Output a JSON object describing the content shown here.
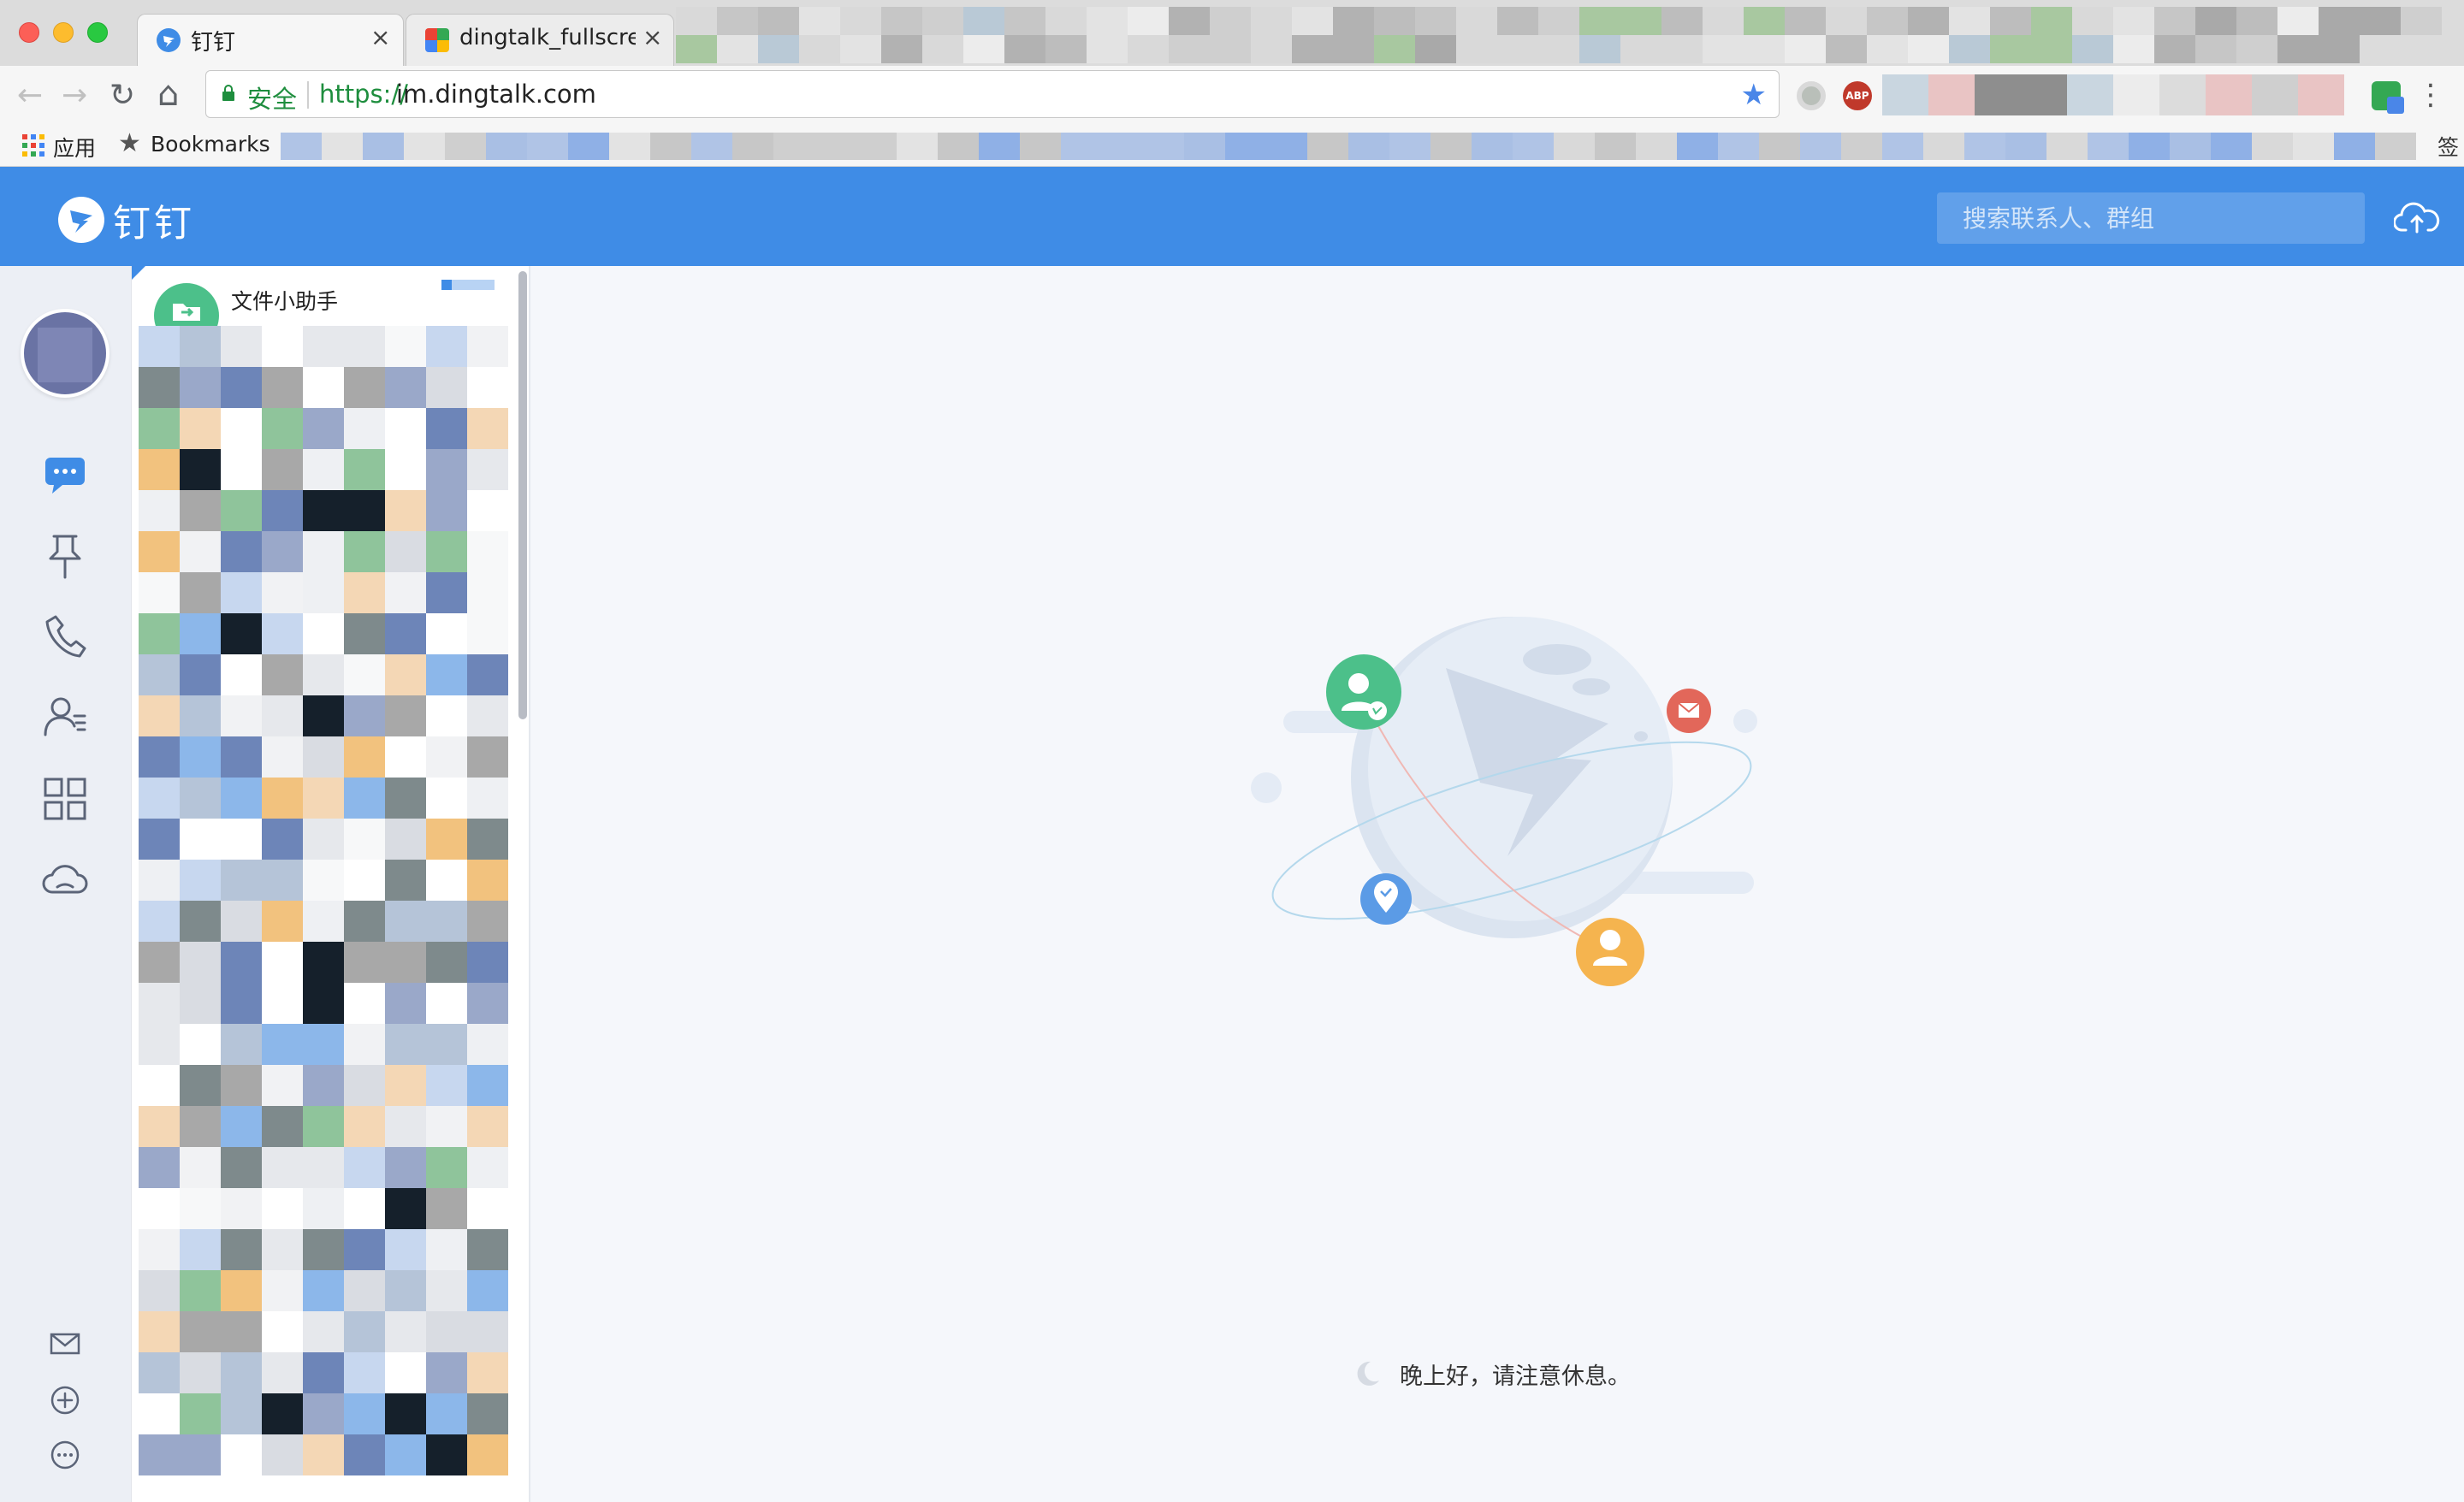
{
  "browser": {
    "tabs": [
      {
        "title": "钉钉",
        "favicon": "dingtalk-icon",
        "active": true
      },
      {
        "title": "dingtalk_fullscreen",
        "favicon": "chrome-extension-icon",
        "active": false
      }
    ],
    "close_glyph": "×",
    "omnibox": {
      "secure_label": "安全",
      "url_scheme": "https://",
      "url_host": "im.dingtalk.com"
    },
    "bookmarks_bar": {
      "apps_label": "应用",
      "bookmarks_label": "Bookmarks",
      "overflow_label": "签"
    },
    "icons": {
      "back": "←",
      "forward": "→",
      "reload": "↻",
      "home": "⌂",
      "star": "★",
      "menu": "⋮"
    }
  },
  "app": {
    "logo_text": "钉钉",
    "search": {
      "placeholder": "搜索联系人、群组"
    },
    "accent_color": "#3f8ce6",
    "side_nav": {
      "items": [
        {
          "name": "messages-icon",
          "active": true
        },
        {
          "name": "ding-icon",
          "active": false
        },
        {
          "name": "phone-icon",
          "active": false
        },
        {
          "name": "contacts-icon",
          "active": false
        },
        {
          "name": "workbench-icon",
          "active": false
        },
        {
          "name": "cloud-drive-icon",
          "active": false
        }
      ],
      "bottom": [
        {
          "name": "mail-icon"
        },
        {
          "name": "add-icon"
        },
        {
          "name": "more-icon"
        }
      ]
    },
    "conversations": {
      "pinned": {
        "name": "文件小助手"
      }
    },
    "main": {
      "greeting": "晚上好，请注意休息。"
    }
  }
}
